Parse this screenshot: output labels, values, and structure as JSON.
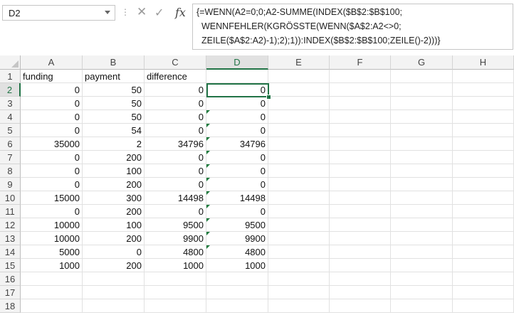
{
  "name_box": "D2",
  "formula_lines": [
    "{=WENN(A2=0;0;A2-SUMME(INDEX($B$2:$B$100;",
    "WENNFEHLER(KGRÖSSTE(WENN($A$2:A2<>0;",
    "ZEILE($A$2:A2)-1);2);1)):INDEX($B$2:$B$100;ZEILE()-2)))}"
  ],
  "icons": {
    "cancel": "✕",
    "enter": "✓",
    "function": "fx",
    "name_box_dropdown": "chevron-down-icon"
  },
  "accent_color": "#217346",
  "columns": [
    "A",
    "B",
    "C",
    "D",
    "E",
    "F",
    "G",
    "H"
  ],
  "rows": [
    {
      "n": "1",
      "a": "funding",
      "b": "payment",
      "c": "difference",
      "d": ""
    },
    {
      "n": "2",
      "a": "0",
      "b": "50",
      "c": "0",
      "d": "0"
    },
    {
      "n": "3",
      "a": "0",
      "b": "50",
      "c": "0",
      "d": "0"
    },
    {
      "n": "4",
      "a": "0",
      "b": "50",
      "c": "0",
      "d": "0"
    },
    {
      "n": "5",
      "a": "0",
      "b": "54",
      "c": "0",
      "d": "0"
    },
    {
      "n": "6",
      "a": "35000",
      "b": "2",
      "c": "34796",
      "d": "34796"
    },
    {
      "n": "7",
      "a": "0",
      "b": "200",
      "c": "0",
      "d": "0"
    },
    {
      "n": "8",
      "a": "0",
      "b": "100",
      "c": "0",
      "d": "0"
    },
    {
      "n": "9",
      "a": "0",
      "b": "200",
      "c": "0",
      "d": "0"
    },
    {
      "n": "10",
      "a": "15000",
      "b": "300",
      "c": "14498",
      "d": "14498"
    },
    {
      "n": "11",
      "a": "0",
      "b": "200",
      "c": "0",
      "d": "0"
    },
    {
      "n": "12",
      "a": "10000",
      "b": "100",
      "c": "9500",
      "d": "9500"
    },
    {
      "n": "13",
      "a": "10000",
      "b": "200",
      "c": "9900",
      "d": "9900"
    },
    {
      "n": "14",
      "a": "5000",
      "b": "0",
      "c": "4800",
      "d": "4800"
    },
    {
      "n": "15",
      "a": "1000",
      "b": "200",
      "c": "1000",
      "d": "1000"
    },
    {
      "n": "16",
      "a": "",
      "b": "",
      "c": "",
      "d": ""
    },
    {
      "n": "17",
      "a": "",
      "b": "",
      "c": "",
      "d": ""
    },
    {
      "n": "18",
      "a": "",
      "b": "",
      "c": "",
      "d": ""
    }
  ]
}
